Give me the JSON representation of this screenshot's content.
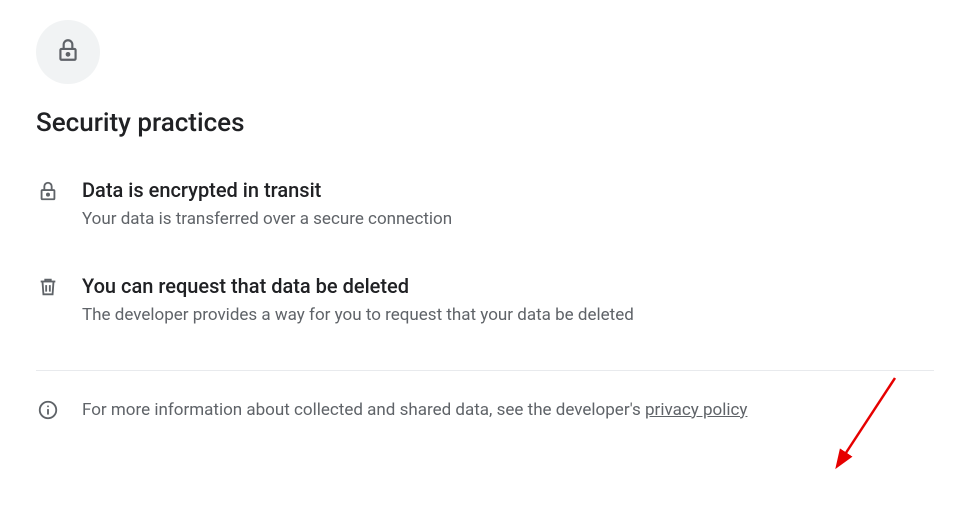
{
  "section": {
    "title": "Security practices"
  },
  "practices": [
    {
      "title": "Data is encrypted in transit",
      "description": "Your data is transferred over a secure connection"
    },
    {
      "title": "You can request that data be deleted",
      "description": "The developer provides a way for you to request that your data be deleted"
    }
  ],
  "footer": {
    "text_prefix": "For more information about collected and shared data, see the developer's ",
    "link_text": "privacy policy"
  }
}
